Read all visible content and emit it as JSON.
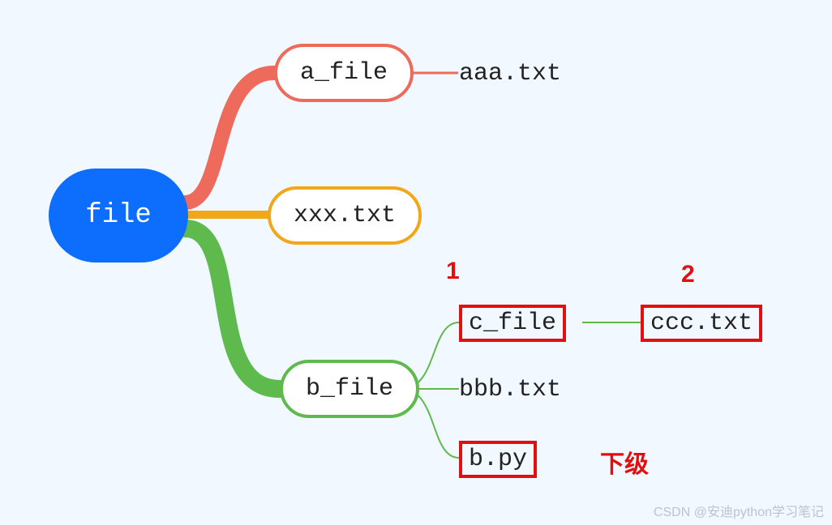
{
  "root": {
    "label": "file"
  },
  "branches": {
    "a": {
      "label": "a_file",
      "leaf": "aaa.txt"
    },
    "x": {
      "label": "xxx.txt"
    },
    "b": {
      "label": "b_file",
      "children": {
        "c": {
          "label": "c_file",
          "leaf": "ccc.txt",
          "highlighted": true
        },
        "bbb": {
          "label": "bbb.txt"
        },
        "py": {
          "label": "b.py",
          "highlighted": true
        }
      }
    }
  },
  "annotations": {
    "one": "1",
    "two": "2",
    "sub": "下级"
  },
  "watermark": "CSDN @安迪python学习笔记",
  "colors": {
    "red": "#ee6a5b",
    "yellow": "#f0a818",
    "green": "#5fba4e",
    "blue": "#0d6efd",
    "highlight": "#e20f0f"
  }
}
